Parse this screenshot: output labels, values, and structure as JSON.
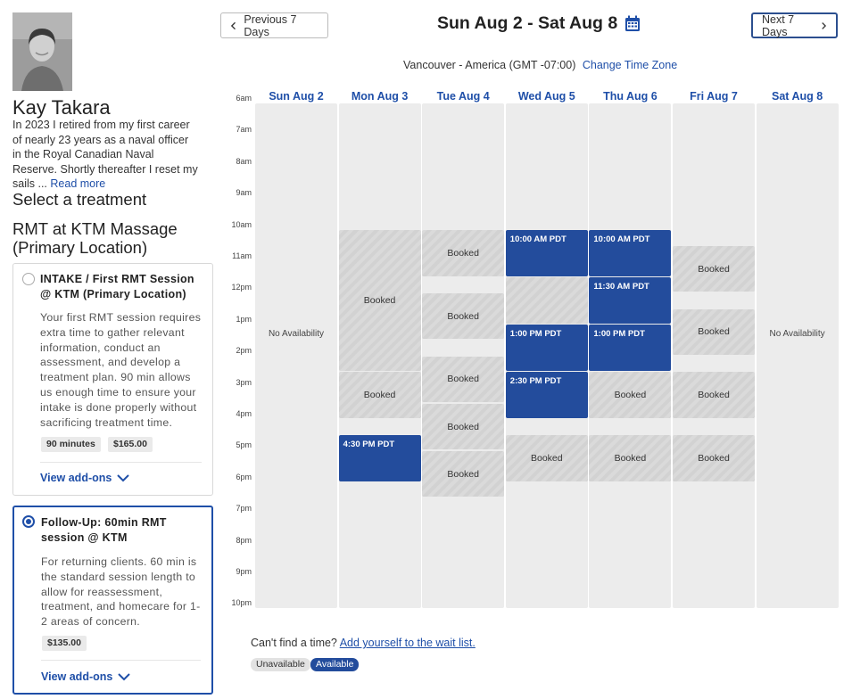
{
  "provider": {
    "name": "Kay Takara",
    "bio": "In 2023 I retired from my first career of nearly 23 years as a naval officer in the Royal Canadian Naval Reserve. Shortly thereafter I reset my sails ...",
    "read_more": "Read more"
  },
  "select_heading": "Select a treatment",
  "location_heading": "RMT at KTM Massage (Primary Location)",
  "treatments": [
    {
      "title": "INTAKE / First RMT Session @ KTM (Primary Location)",
      "description": "Your first RMT session requires extra time to gather relevant information, conduct an assessment, and develop a treatment plan. 90 min allows us enough time to ensure your intake is done properly without sacrificing treatment time.",
      "duration": "90 minutes",
      "price": "$165.00",
      "addons_label": "View add-ons",
      "selected": false
    },
    {
      "title": "Follow-Up: 60min RMT session @ KTM",
      "description": "For returning clients. 60 min is the standard session length to allow for reassessment, treatment, and homecare for 1-2 areas of concern.",
      "price": "$135.00",
      "addons_label": "View add-ons",
      "selected": true
    }
  ],
  "nav": {
    "prev_label": "Previous 7 Days",
    "next_label": "Next 7 Days",
    "date_range": "Sun Aug 2 - Sat Aug 8"
  },
  "timezone": {
    "text": "Vancouver - America (GMT -07:00)",
    "change_label": "Change Time Zone"
  },
  "hours": [
    "6am",
    "7am",
    "8am",
    "9am",
    "10am",
    "11am",
    "12pm",
    "1pm",
    "2pm",
    "3pm",
    "4pm",
    "5pm",
    "6pm",
    "7pm",
    "8pm",
    "9pm",
    "10pm"
  ],
  "days": [
    {
      "label": "Sun Aug 2",
      "no_availability": "No Availability",
      "blocks": []
    },
    {
      "label": "Mon Aug 3",
      "blocks": [
        {
          "type": "booked",
          "start": 10.0,
          "end": 14.5,
          "label": "Booked"
        },
        {
          "type": "booked",
          "start": 14.5,
          "end": 16.0,
          "label": "Booked"
        },
        {
          "type": "available",
          "start": 16.5,
          "end": 18.0,
          "label": "4:30 PM PDT"
        }
      ]
    },
    {
      "label": "Tue Aug 4",
      "blocks": [
        {
          "type": "booked",
          "start": 10.0,
          "end": 11.5,
          "label": "Booked"
        },
        {
          "type": "booked",
          "start": 12.0,
          "end": 13.5,
          "label": "Booked"
        },
        {
          "type": "booked",
          "start": 14.0,
          "end": 15.5,
          "label": "Booked"
        },
        {
          "type": "booked",
          "start": 15.5,
          "end": 17.0,
          "label": "Booked"
        },
        {
          "type": "booked",
          "start": 17.0,
          "end": 18.5,
          "label": "Booked"
        }
      ]
    },
    {
      "label": "Wed Aug 5",
      "blocks": [
        {
          "type": "available",
          "start": 10.0,
          "end": 11.5,
          "label": "10:00 AM PDT"
        },
        {
          "type": "booked",
          "start": 11.5,
          "end": 13.0,
          "label": ""
        },
        {
          "type": "available",
          "start": 13.0,
          "end": 14.5,
          "label": "1:00 PM PDT"
        },
        {
          "type": "available",
          "start": 14.5,
          "end": 16.0,
          "label": "2:30 PM PDT"
        },
        {
          "type": "booked",
          "start": 16.5,
          "end": 18.0,
          "label": "Booked"
        }
      ]
    },
    {
      "label": "Thu Aug 6",
      "blocks": [
        {
          "type": "available",
          "start": 10.0,
          "end": 11.5,
          "label": "10:00 AM PDT"
        },
        {
          "type": "available",
          "start": 11.5,
          "end": 13.0,
          "label": "11:30 AM PDT"
        },
        {
          "type": "available",
          "start": 13.0,
          "end": 14.5,
          "label": "1:00 PM PDT"
        },
        {
          "type": "booked",
          "start": 14.5,
          "end": 16.0,
          "label": "Booked"
        },
        {
          "type": "booked",
          "start": 16.5,
          "end": 18.0,
          "label": "Booked"
        }
      ]
    },
    {
      "label": "Fri Aug 7",
      "blocks": [
        {
          "type": "booked",
          "start": 10.5,
          "end": 12.0,
          "label": "Booked"
        },
        {
          "type": "booked",
          "start": 12.5,
          "end": 14.0,
          "label": "Booked"
        },
        {
          "type": "booked",
          "start": 14.5,
          "end": 16.0,
          "label": "Booked"
        },
        {
          "type": "booked",
          "start": 16.5,
          "end": 18.0,
          "label": "Booked"
        }
      ]
    },
    {
      "label": "Sat Aug 8",
      "no_availability": "No Availability",
      "blocks": []
    }
  ],
  "waitlist": {
    "text": "Can't find a time?",
    "link": "Add yourself to the wait list."
  },
  "legend": {
    "unavailable": "Unavailable",
    "available": "Available"
  },
  "colors": {
    "accent": "#1f4fa8",
    "available_block": "#234c9c",
    "column_bg": "#ececec"
  }
}
